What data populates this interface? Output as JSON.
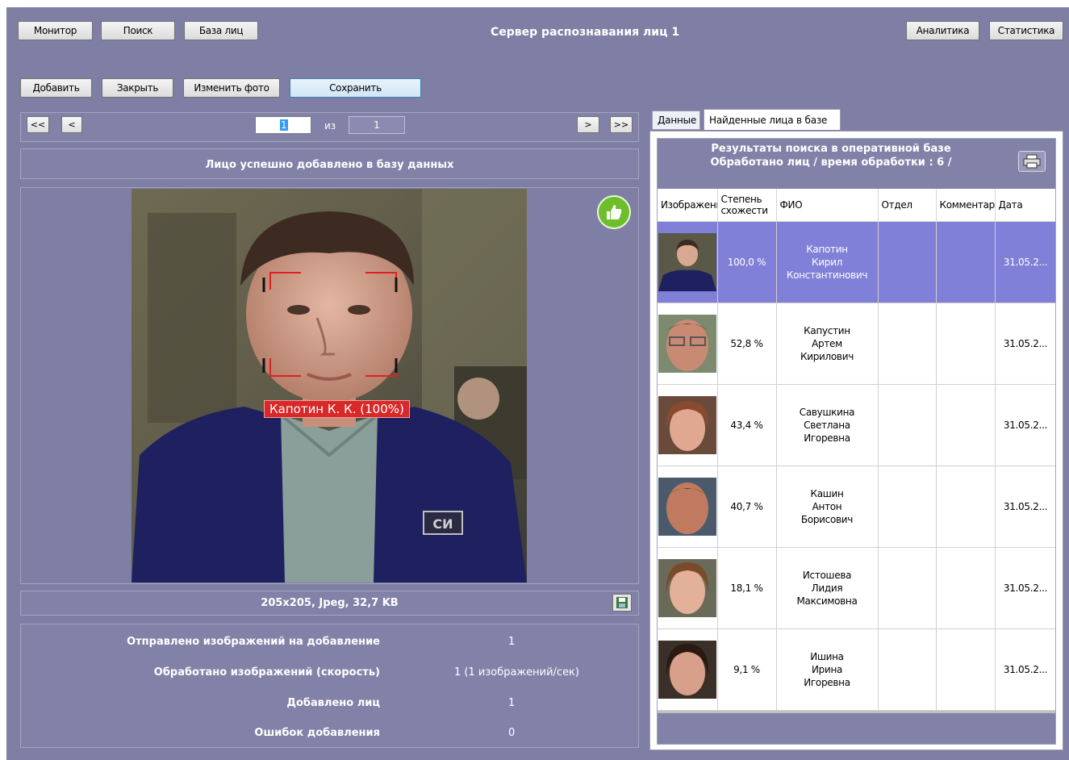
{
  "toolbar": {
    "monitor": "Монитор",
    "search": "Поиск",
    "face_db": "База лиц",
    "title": "Сервер распознавания лиц 1",
    "analytics": "Аналитика",
    "statistics": "Статистика"
  },
  "actions": {
    "add": "Добавить",
    "close": "Закрыть",
    "change_photo": "Изменить фото",
    "save": "Сохранить"
  },
  "pager": {
    "first": "<<",
    "prev": "<",
    "current": "1",
    "of": "из",
    "total": "1",
    "next": ">",
    "last": ">>"
  },
  "status_message": "Лицо успешно добавлено в базу данных",
  "face_label": "Капотин К. К. (100%)",
  "image_info": "205x205, Jpeg, 32,7 KB",
  "stats": [
    {
      "label": "Отправлено изображений на добавление",
      "value": "1"
    },
    {
      "label": "Обработано изображений (скорость)",
      "value": "1 (1 изображений/сек)"
    },
    {
      "label": "Добавлено лиц",
      "value": "1"
    },
    {
      "label": "Ошибок добавления",
      "value": "0"
    }
  ],
  "tabs": {
    "data": "Данные",
    "found": "Найденные лица в базе"
  },
  "results_header": {
    "line1": "Результаты поиска в оперативной базе",
    "line2": "Обработано лиц / время обработки : 6 /"
  },
  "table": {
    "columns": [
      "Изображение",
      "Степень схожести",
      "ФИО",
      "Отдел",
      "Комментарий",
      "Дата"
    ],
    "rows": [
      {
        "similarity": "100,0 %",
        "name": [
          "Капотин",
          "Кирил",
          "Константинович"
        ],
        "dept": "",
        "comment": "",
        "date": "31.05.2..."
      },
      {
        "similarity": "52,8 %",
        "name": [
          "Капустин",
          "Артем",
          "Кирилович"
        ],
        "dept": "",
        "comment": "",
        "date": "31.05.2..."
      },
      {
        "similarity": "43,4 %",
        "name": [
          "Савушкина",
          "Светлана",
          "Игоревна"
        ],
        "dept": "",
        "comment": "",
        "date": "31.05.2..."
      },
      {
        "similarity": "40,7 %",
        "name": [
          "Кашин",
          "Антон",
          "Борисович"
        ],
        "dept": "",
        "comment": "",
        "date": "31.05.2..."
      },
      {
        "similarity": "18,1 %",
        "name": [
          "Истошева",
          "Лидия",
          "Максимовна"
        ],
        "dept": "",
        "comment": "",
        "date": "31.05.2..."
      },
      {
        "similarity": "9,1 %",
        "name": [
          "Ишина",
          "Ирина",
          "Игоревна"
        ],
        "dept": "",
        "comment": "",
        "date": "31.05.2..."
      }
    ]
  },
  "colors": {
    "background": "#7f7fa6",
    "selected_row": "#8080d8",
    "face_box": "#e02020"
  }
}
